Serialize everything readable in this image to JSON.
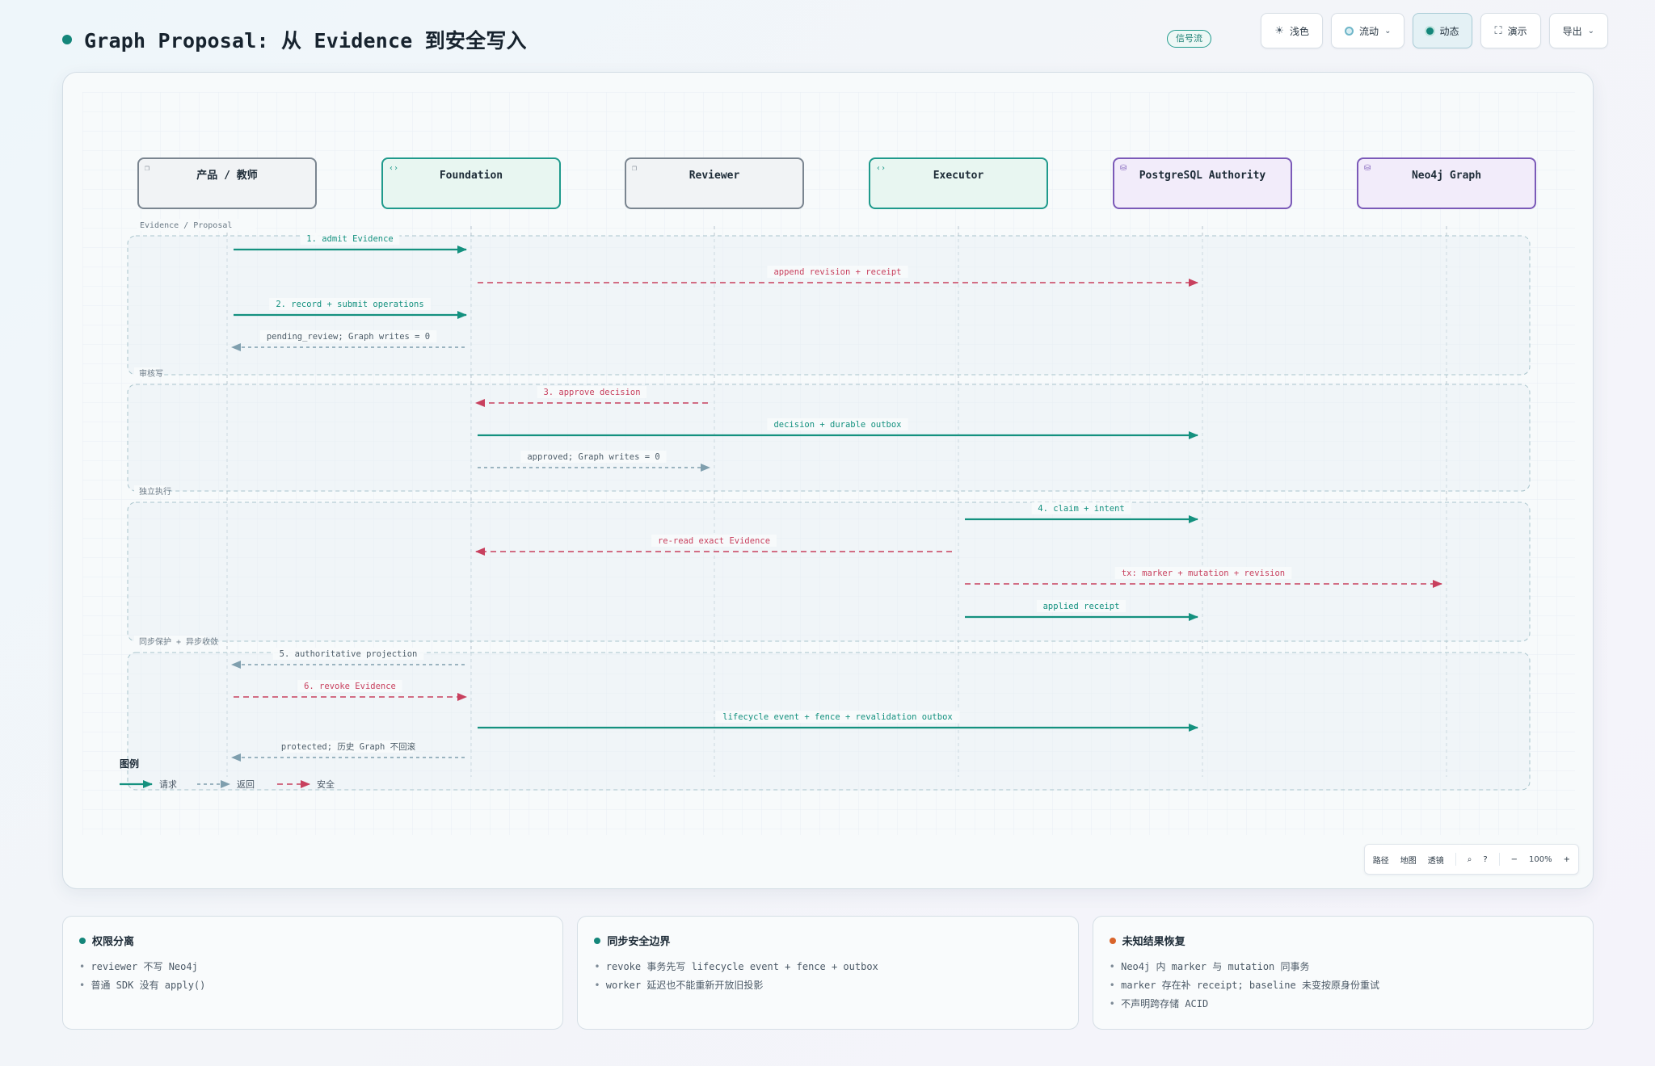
{
  "header": {
    "title": "Graph Proposal: 从 Evidence 到安全写入",
    "badge": "信号流"
  },
  "toolbar": {
    "theme_label": "浅色",
    "flow_label": "流动",
    "dynamic_label": "动态",
    "present_label": "演示",
    "export_label": "导出"
  },
  "diagram": {
    "participants": [
      {
        "label": "产品 / 教师",
        "kind": "external",
        "icon": "window-icon",
        "color": "#7a8590"
      },
      {
        "label": "Foundation",
        "kind": "service",
        "icon": "code-icon",
        "color": "#1f9a8c"
      },
      {
        "label": "Reviewer",
        "kind": "external",
        "icon": "window-icon",
        "color": "#7a8590"
      },
      {
        "label": "Executor",
        "kind": "service",
        "icon": "code-icon",
        "color": "#1f9a8c"
      },
      {
        "label": "PostgreSQL Authority",
        "kind": "store",
        "icon": "database-icon",
        "color": "#7b5ab8"
      },
      {
        "label": "Neo4j Graph",
        "kind": "store",
        "icon": "database-icon",
        "color": "#7b5ab8"
      }
    ],
    "groups": [
      {
        "label": "Evidence / Proposal"
      },
      {
        "label": "审核写"
      },
      {
        "label": "独立执行"
      },
      {
        "label": "同步保护 + 异步收敛"
      }
    ],
    "messages": [
      {
        "from": 0,
        "to": 1,
        "label": "1. admit Evidence",
        "style": "request"
      },
      {
        "from": 1,
        "to": 4,
        "label": "append revision + receipt",
        "style": "security"
      },
      {
        "from": 0,
        "to": 1,
        "label": "2. record + submit operations",
        "style": "request"
      },
      {
        "from": 1,
        "to": 0,
        "label": "pending_review; Graph writes = 0",
        "style": "return"
      },
      {
        "from": 2,
        "to": 1,
        "label": "3. approve decision",
        "style": "security"
      },
      {
        "from": 1,
        "to": 4,
        "label": "decision + durable outbox",
        "style": "request"
      },
      {
        "from": 1,
        "to": 2,
        "label": "approved; Graph writes = 0",
        "style": "return"
      },
      {
        "from": 3,
        "to": 4,
        "label": "4. claim + intent",
        "style": "request"
      },
      {
        "from": 3,
        "to": 1,
        "label": "re-read exact Evidence",
        "style": "security"
      },
      {
        "from": 3,
        "to": 5,
        "label": "tx: marker + mutation + revision",
        "style": "security"
      },
      {
        "from": 3,
        "to": 4,
        "label": "applied receipt",
        "style": "request"
      },
      {
        "from": 1,
        "to": 0,
        "label": "5. authoritative projection",
        "style": "return"
      },
      {
        "from": 0,
        "to": 1,
        "label": "6. revoke Evidence",
        "style": "security"
      },
      {
        "from": 1,
        "to": 4,
        "label": "lifecycle event + fence + revalidation outbox",
        "style": "request"
      },
      {
        "from": 1,
        "to": 0,
        "label": "protected; 历史 Graph 不回滚",
        "style": "return"
      }
    ],
    "legend": {
      "title": "图例",
      "request": "请求",
      "return": "返回",
      "security": "安全"
    },
    "colors": {
      "request": "#14917f",
      "return": "#7f9fae",
      "security": "#c8405e"
    }
  },
  "zoom_bar": {
    "path_label": "路径",
    "map_label": "地图",
    "lens_label": "透镜",
    "search_icon": "search-icon",
    "help_icon": "help-icon",
    "zoom_out": "−",
    "zoom_level": "100%",
    "zoom_in": "+"
  },
  "cards": [
    {
      "title": "权限分离",
      "dot_color": "#14867a",
      "items": [
        "reviewer 不写 Neo4j",
        "普通 SDK 没有 apply()"
      ]
    },
    {
      "title": "同步安全边界",
      "dot_color": "#14867a",
      "items": [
        "revoke 事务先写 lifecycle event + fence + outbox",
        "worker 延迟也不能重新开放旧投影"
      ]
    },
    {
      "title": "未知结果恢复",
      "dot_color": "#d9642b",
      "items": [
        "Neo4j 内 marker 与 mutation 同事务",
        "marker 存在补 receipt; baseline 未变按原身份重试",
        "不声明跨存储 ACID"
      ]
    }
  ]
}
